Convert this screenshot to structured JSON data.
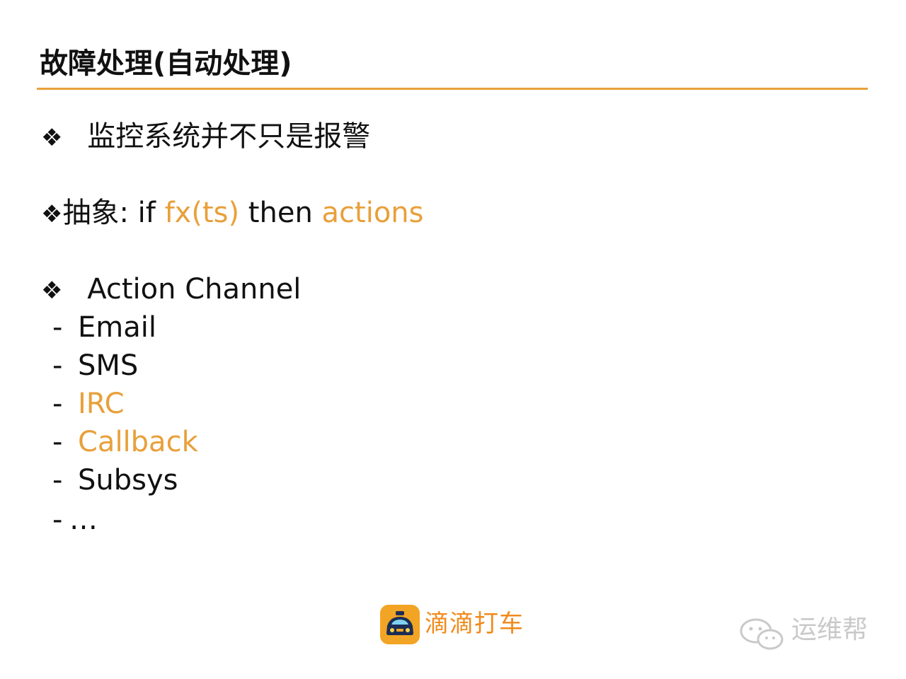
{
  "slide": {
    "title": "故障处理(自动处理)",
    "bullet_glyph": "❖",
    "point1": {
      "text": "监控系统并不只是报警"
    },
    "point2": {
      "prefix": "抽象: if ",
      "fx": "fx(ts)",
      "middle": " then ",
      "actions": "actions"
    },
    "point3": {
      "text": "Action Channel",
      "items": [
        {
          "dash": "-",
          "label": "Email",
          "highlight": false
        },
        {
          "dash": "-",
          "label": "SMS",
          "highlight": false
        },
        {
          "dash": "-",
          "label": "IRC",
          "highlight": true
        },
        {
          "dash": "-",
          "label": "Callback",
          "highlight": true
        },
        {
          "dash": "-",
          "label": "Subsys",
          "highlight": false
        },
        {
          "dash": "-",
          "label": "…",
          "highlight": false
        }
      ]
    }
  },
  "footer": {
    "brand": "滴滴打车",
    "logo_icon": "taxi-car-icon",
    "watermark": "运维帮",
    "watermark_icon": "wechat-icon"
  },
  "colors": {
    "accent": "#e8a03a",
    "brand": "#f08a1a",
    "text": "#111111",
    "watermark": "#c9c9c9"
  }
}
